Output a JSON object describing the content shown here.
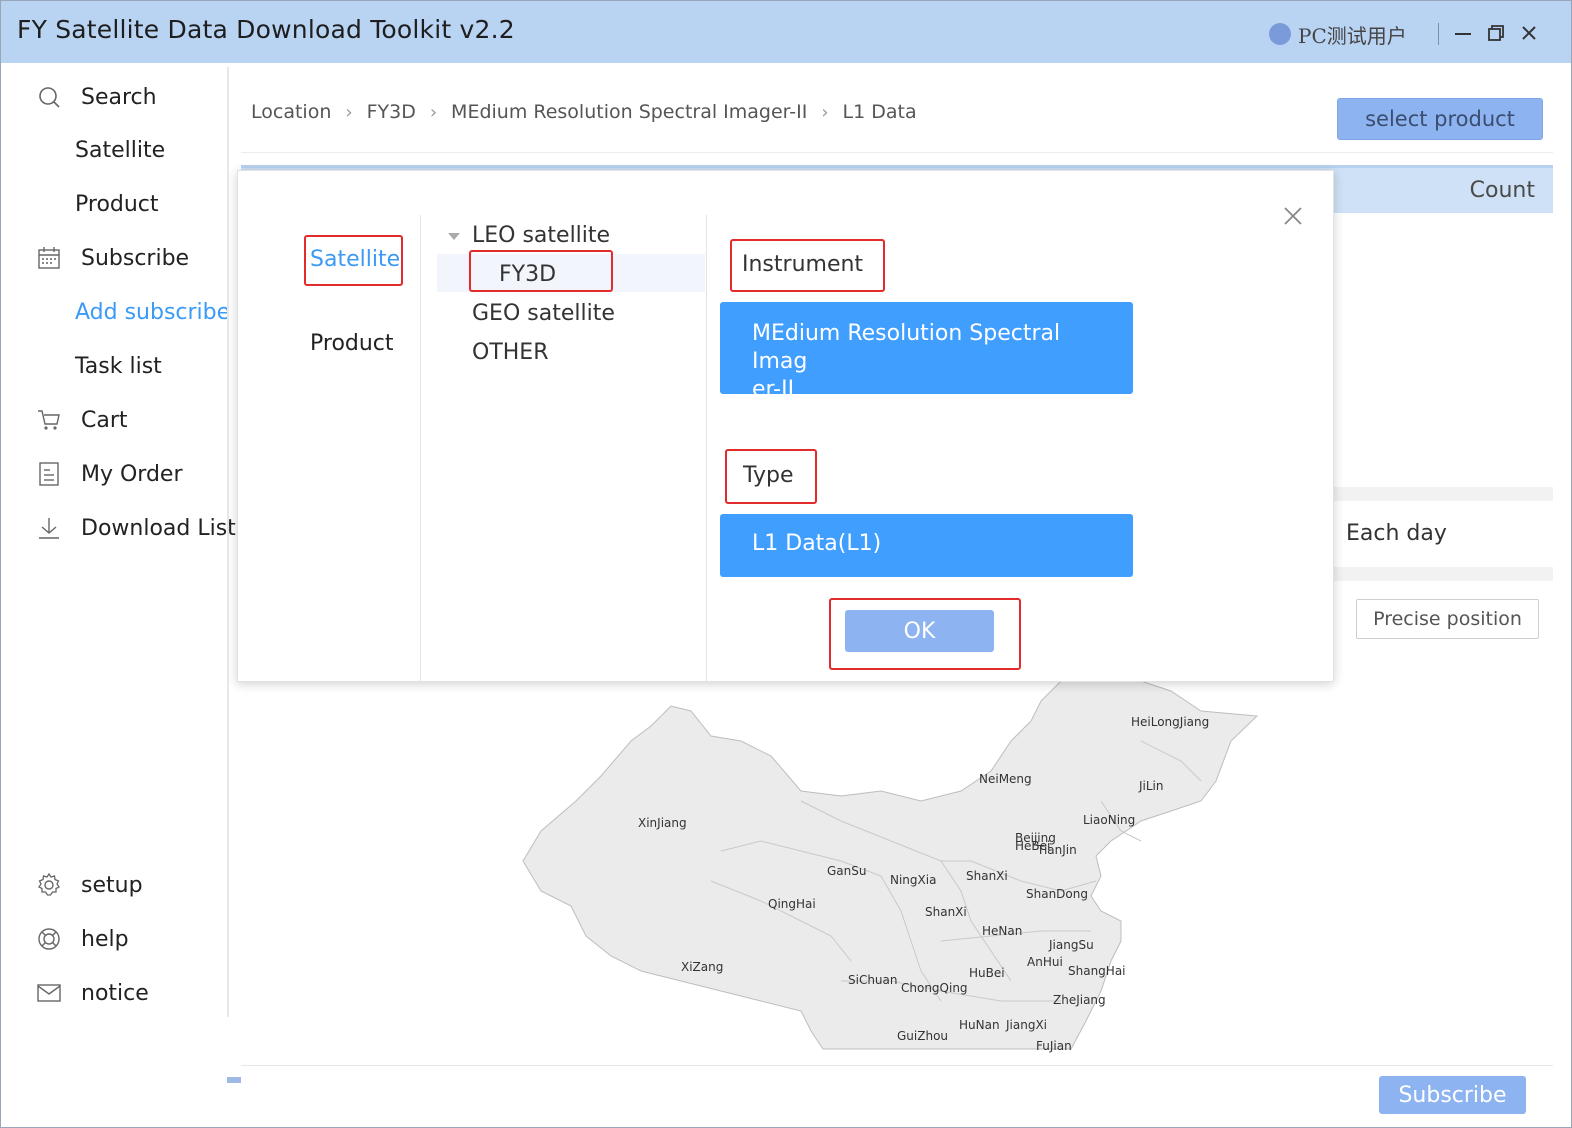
{
  "app": {
    "title": "FY Satellite Data Download Toolkit v2.2",
    "user_name": "PC测试用户"
  },
  "sidebar": {
    "items": [
      {
        "label": "Search",
        "icon": "search-icon"
      },
      {
        "label": "Satellite"
      },
      {
        "label": "Product"
      },
      {
        "label": "Subscribe",
        "icon": "calendar-icon"
      },
      {
        "label": "Add subscribe",
        "active": true
      },
      {
        "label": "Task list"
      },
      {
        "label": "Cart",
        "icon": "cart-icon"
      },
      {
        "label": "My Order",
        "icon": "order-icon"
      },
      {
        "label": "Download List",
        "icon": "download-icon"
      }
    ],
    "bottom_items": [
      {
        "label": "setup",
        "icon": "gear-icon"
      },
      {
        "label": "help",
        "icon": "help-icon"
      },
      {
        "label": "notice",
        "icon": "mail-icon"
      }
    ]
  },
  "breadcrumb": [
    "Location",
    "FY3D",
    "MEdium Resolution Spectral Imager-II",
    "L1 Data"
  ],
  "toolbar": {
    "select_product_label": "select product"
  },
  "table": {
    "count_header": "Count"
  },
  "filters": {
    "each_day_label": "Each day",
    "precise_position_label": "Precise position"
  },
  "footer": {
    "subscribe_label": "Subscribe"
  },
  "modal": {
    "tabs": [
      "Satellite",
      "Product"
    ],
    "tree": {
      "leo_label": "LEO satellite",
      "selected_child": "FY3D",
      "geo_label": "GEO satellite",
      "other_label": "OTHER"
    },
    "instrument_label": "Instrument",
    "instrument_option_line1": "MEdium Resolution Spectral Imag",
    "instrument_option_line2": "er-II",
    "type_label": "Type",
    "type_option": "L1 Data(L1)",
    "ok_label": "OK"
  },
  "map": {
    "provinces": [
      "HeiLongJiang",
      "NeiMeng",
      "JiLin",
      "LiaoNing",
      "XinJiang",
      "Beijing",
      "HeBei",
      "TianJin",
      "GanSu",
      "NingXia",
      "ShanXi",
      "ShanDong",
      "QingHai",
      "ShanXi",
      "HeNan",
      "JiangSu",
      "AnHui",
      "ShangHai",
      "XiZang",
      "SiChuan",
      "ChongQing",
      "HuBei",
      "ZheJiang",
      "HuNan",
      "JiangXi",
      "GuiZhou",
      "FuJian"
    ]
  },
  "colors": {
    "accent": "#409eff",
    "title_bar": "#b9d3f3",
    "highlight_box": "#e32b2b",
    "muted_button": "#8db4f1"
  }
}
